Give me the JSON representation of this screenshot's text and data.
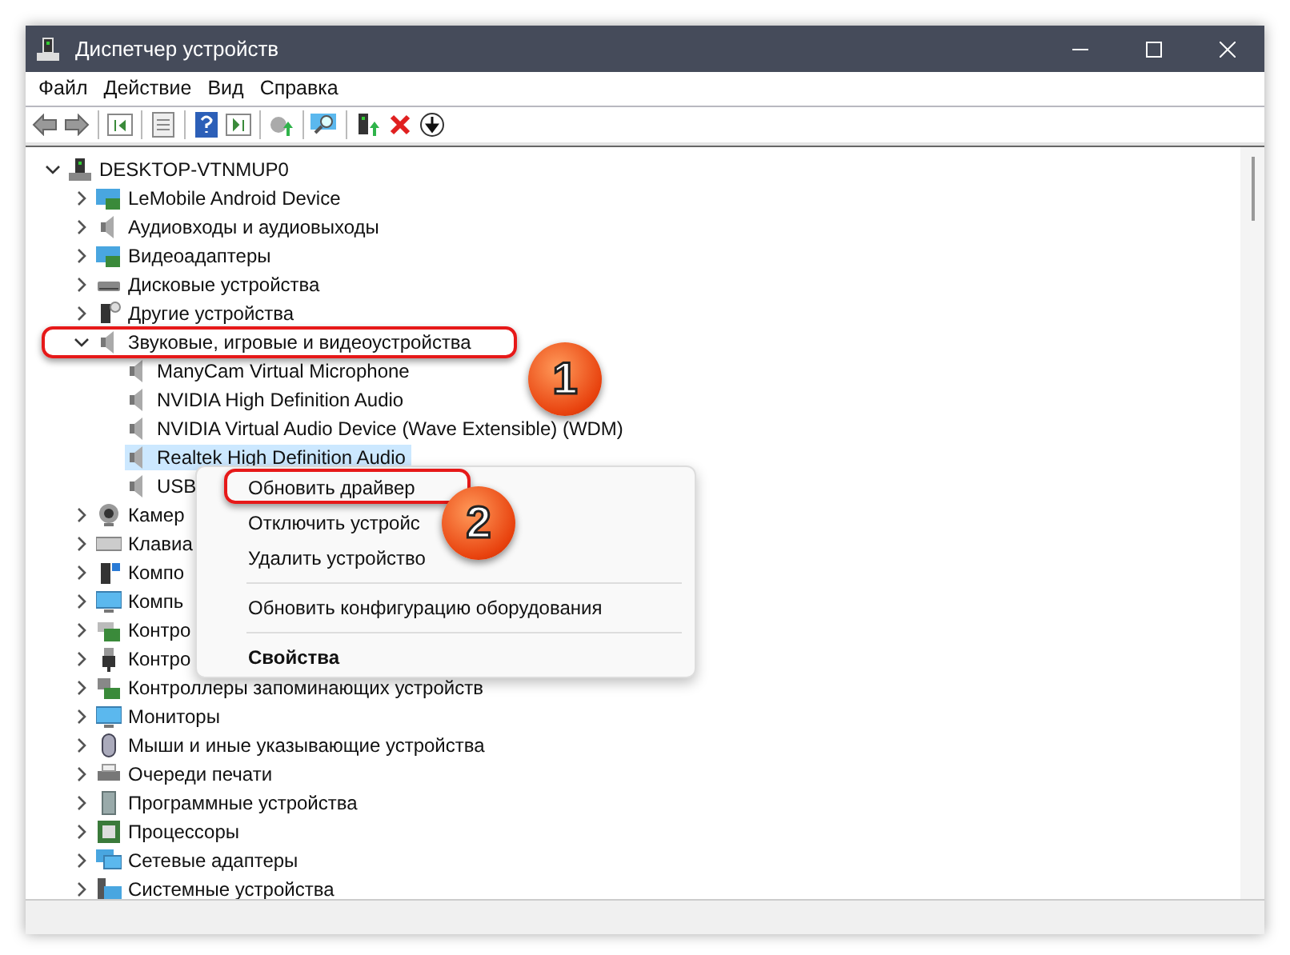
{
  "window": {
    "title": "Диспетчер устройств"
  },
  "menu": [
    "Файл",
    "Действие",
    "Вид",
    "Справка"
  ],
  "tree": [
    {
      "label": "DESKTOP-VTNMUP0",
      "kind": "computer",
      "expanded": true,
      "selected": false,
      "children": [
        {
          "label": "LeMobile Android Device",
          "kind": "display",
          "expanded": false,
          "selected": false
        },
        {
          "label": "Аудиовходы и аудиовыходы",
          "kind": "speaker",
          "expanded": false,
          "selected": false
        },
        {
          "label": "Видеоадаптеры",
          "kind": "display",
          "expanded": false,
          "selected": false
        },
        {
          "label": "Дисковые устройства",
          "kind": "disk",
          "expanded": false,
          "selected": false
        },
        {
          "label": "Другие устройства",
          "kind": "unknown",
          "expanded": false,
          "selected": false
        },
        {
          "label": "Звуковые, игровые и видеоустройства",
          "kind": "speaker",
          "expanded": true,
          "selected": false,
          "children": [
            {
              "label": "ManyCam Virtual Microphone",
              "kind": "speaker",
              "selected": false
            },
            {
              "label": "NVIDIA High Definition Audio",
              "kind": "speaker",
              "selected": false
            },
            {
              "label": "NVIDIA Virtual Audio Device (Wave Extensible) (WDM)",
              "kind": "speaker",
              "selected": false
            },
            {
              "label": "Realtek High Definition Audio",
              "kind": "speaker",
              "selected": true
            },
            {
              "label": "USB",
              "kind": "speaker",
              "selected": false
            }
          ]
        },
        {
          "label": "Камер",
          "kind": "camera",
          "expanded": false,
          "selected": false
        },
        {
          "label": "Клавиа",
          "kind": "keyboard",
          "expanded": false,
          "selected": false
        },
        {
          "label": "Компо",
          "kind": "component",
          "expanded": false,
          "selected": false
        },
        {
          "label": "Компь",
          "kind": "monitor",
          "expanded": false,
          "selected": false
        },
        {
          "label": "Контро",
          "kind": "controller",
          "expanded": false,
          "selected": false
        },
        {
          "label": "Контро",
          "kind": "usb",
          "expanded": false,
          "selected": false
        },
        {
          "label": "Контроллеры запоминающих устройств",
          "kind": "storage",
          "expanded": false,
          "selected": false
        },
        {
          "label": "Мониторы",
          "kind": "monitor",
          "expanded": false,
          "selected": false
        },
        {
          "label": "Мыши и иные указывающие устройства",
          "kind": "mouse",
          "expanded": false,
          "selected": false
        },
        {
          "label": "Очереди печати",
          "kind": "printer",
          "expanded": false,
          "selected": false
        },
        {
          "label": "Программные устройства",
          "kind": "software",
          "expanded": false,
          "selected": false
        },
        {
          "label": "Процессоры",
          "kind": "cpu",
          "expanded": false,
          "selected": false
        },
        {
          "label": "Сетевые адаптеры",
          "kind": "network",
          "expanded": false,
          "selected": false
        },
        {
          "label": "Системные устройства",
          "kind": "system",
          "expanded": false,
          "selected": false
        }
      ]
    }
  ],
  "context_menu": [
    {
      "kind": "item",
      "label": "Обновить драйвер",
      "bold": false
    },
    {
      "kind": "item",
      "label": "Отключить устройс",
      "bold": false
    },
    {
      "kind": "item",
      "label": "Удалить устройство",
      "bold": false
    },
    {
      "kind": "separator"
    },
    {
      "kind": "item",
      "label": "Обновить конфигурацию оборудования",
      "bold": false
    },
    {
      "kind": "separator"
    },
    {
      "kind": "item",
      "label": "Свойства",
      "bold": true
    }
  ],
  "annotations": [
    "1",
    "2"
  ]
}
